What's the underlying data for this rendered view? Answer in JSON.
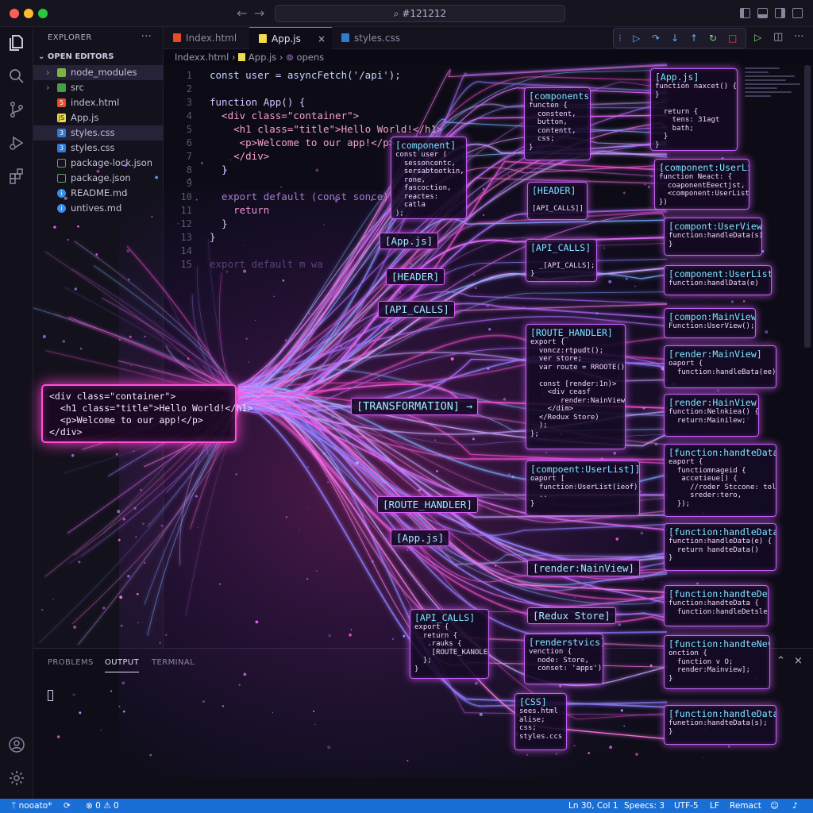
{
  "titlebar": {
    "search_text": "⌕ #121212",
    "traffic_colors": [
      "#ff5f57",
      "#febc2e",
      "#28c840"
    ]
  },
  "sidebar": {
    "title": "EXPLORER",
    "more": "···",
    "section": "OPEN EDITORS",
    "items": [
      {
        "label": "node_modules",
        "icon": "folder-icon",
        "kind": "folder"
      },
      {
        "label": "src",
        "icon": "folder-icon",
        "kind": "folder"
      },
      {
        "label": "index.html",
        "icon": "html-file-icon",
        "kind": "file"
      },
      {
        "label": "App.js",
        "icon": "js-file-icon",
        "kind": "file"
      },
      {
        "label": "styles.css",
        "icon": "css-file-icon",
        "kind": "file"
      },
      {
        "label": "styles.css",
        "icon": "css-file-icon",
        "kind": "file"
      },
      {
        "label": "package-lock.json",
        "icon": "npm-file-icon",
        "kind": "file"
      },
      {
        "label": "package.json",
        "icon": "npm-file-icon",
        "kind": "file"
      },
      {
        "label": "README.md",
        "icon": "info-file-icon",
        "kind": "file"
      },
      {
        "label": "untives.md",
        "icon": "info-file-icon",
        "kind": "file"
      }
    ]
  },
  "tabs": [
    {
      "label": "Index.html",
      "icon": "html-file-icon",
      "active": false
    },
    {
      "label": "App.js",
      "icon": "js-file-icon",
      "active": true
    },
    {
      "label": "styles.css",
      "icon": "css-file-icon",
      "active": false
    }
  ],
  "tab_close": "×",
  "breadcrumb": {
    "a": "Indexx.html",
    "b": "App.js",
    "c": "opens"
  },
  "editor": {
    "lines": [
      "1",
      "2",
      "3",
      "4",
      "5",
      "6",
      "7",
      "8",
      "9",
      "10",
      "11",
      "12",
      "13",
      "14",
      "15"
    ],
    "code": {
      "l1": "const user = asyncFetch('/api');",
      "l3": "function App() {",
      "l4": "  <div class=\"container\">",
      "l5": "    <h1 class=\"title\">Hello World!</h1>",
      "l6": "     <p>Welcome to our app!</p>",
      "l7": "    </div>",
      "l8": "  }",
      "l10": "  export default (const sonce)(",
      "l11": "    return",
      "l12": "  }",
      "l13": "}",
      "l14": "export default m wa"
    }
  },
  "art": {
    "source": [
      "<div class=\"container\">",
      "  <h1 class=\"title\">Hello World!</h1>",
      "  <p>Welcome to our app!</p>",
      "</div>"
    ],
    "labels": {
      "transformation": "[TRANSFORMATION] →",
      "appjs1": "[App.js]",
      "header1": "[HEADER]",
      "apicalls1": "[API_CALLS]",
      "route1": "[ROUTE_HANDLER]",
      "appjs2": "[App.js]",
      "render_main": "[render:NainView]",
      "redux": "[Redux Store]"
    },
    "boxes": {
      "component": {
        "title": "[component]",
        "body": "const user (\n  sessoncontc,\n  sersabtootkin,\n  rone,\n  fascoction,\n  reactes:\n  catla\n);"
      },
      "components": {
        "title": "[components]",
        "body": "functen {\n  constent,\n  button,\n  contentt,\n  css;\n}"
      },
      "header": {
        "title": "[HEADER]",
        "body": "\n[API_CALLS]]"
      },
      "api_calls": {
        "title": "[API_CALLS]",
        "body": "\n  _[API_CALLS];\n}"
      },
      "route_handler": {
        "title": "[ROUTE_HANDLER]",
        "body": "export {\n  voncz:rtpudt();\n  ver store;\n  var route = RROOTE();\n\n  const [render:1n)>\n    <div ceasf\n       render:NainView;\n    </dim>\n  </Redux Store)\n  );\n};"
      },
      "userlist_mid": {
        "title": "[compoent:UserList]]",
        "body": "oaport [\n  function:UserList(ieof);\n  ..\n}"
      },
      "api_calls_low": {
        "title": "[API_CALLS]",
        "body": "export {\n  return {\n   .rauks {\n    [ROUTE_KANOLER]\n  };\n}"
      },
      "renderstvics": {
        "title": "[renderstvics]",
        "body": "venction {\n  node: Store,\n  conset: 'apps');"
      },
      "css": {
        "title": "[CSS]",
        "body": "sees.html\nalise;\ncss;\nstyles.ccs"
      },
      "r_appjs": {
        "title": "[App.js]",
        "body": "function naxcet() {\n}\n\n  return {\n    tens: 31agt\n    bath;\n  }\n}"
      },
      "r_userlist": {
        "title": "[component:UserList]",
        "body": "function Neact: {\n  coaponentEeectjst,\n  <component:UserList;\n})"
      },
      "r_userview": {
        "title": "[compont:UserView]",
        "body": "function:handleData(s)\n}"
      },
      "r_userlist2": {
        "title": "[component:UserList]]",
        "body": "function:handlData(e)"
      },
      "r_mainview": {
        "title": "[compon:MainView]",
        "body": "Function:UserView();"
      },
      "r_render_main": {
        "title": "[render:MainView]",
        "body": "oaport {\n  function:handleBata(ee));"
      },
      "r_render_hain": {
        "title": "[render:HainView]",
        "body": "function:Nelnkiea() {\n  return:Mainilew;"
      },
      "r_handle1": {
        "title": "[function:handteData(e)]",
        "body": "eaport {\n  functiomnageid {\n   accetieue[) {\n     //roder Stccone: tolle,\n     sreder:tero,\n  });"
      },
      "r_handle2": {
        "title": "[function:handleData(e)]",
        "body": "function:handleData(e) {\n  return handteData()\n}"
      },
      "r_handle3": {
        "title": "[function:handteDet(e]",
        "body": "function:handteData {\n  function:handleDetsle);"
      },
      "r_handle4": {
        "title": "[function:handteNev(e)]",
        "body": "onction {\n  function v O;\n  render:Mainview];\n}"
      },
      "r_handle5": {
        "title": "[function:handleData(e)]",
        "body": "funetion:handteData(s);\n}"
      }
    }
  },
  "panel": {
    "tabs": [
      "PROBLEMS",
      "OUTPUT",
      "TERMINAL"
    ],
    "active": 1
  },
  "statusbar": {
    "branch": "nooato*",
    "errors": "0",
    "warnings": "0",
    "position": "Ln 30, Col 1",
    "spaces": "Speecs: 3",
    "encoding": "UTF-5",
    "eol": "LF",
    "language": "Remact"
  },
  "colors": {
    "accent": "#d54bd8",
    "status": "#1a6fd6",
    "glow_pink": "#ff4fd8",
    "glow_violet": "#c45ff5",
    "cyan_text": "#7fe3ff"
  }
}
